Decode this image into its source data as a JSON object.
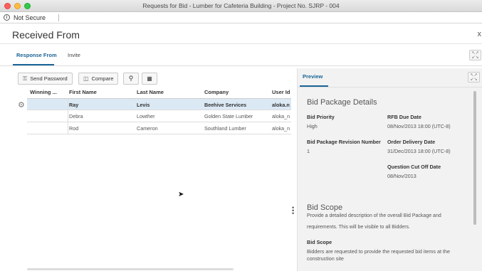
{
  "window": {
    "title": "Requests for Bid - Lumber for Cafeteria Building - Project No. SJRP - 004"
  },
  "urlbar": {
    "security_text": "Not Secure"
  },
  "page": {
    "title": "Received From",
    "close_glyph": "x"
  },
  "tabs": [
    {
      "label": "Response From"
    },
    {
      "label": "Invite"
    }
  ],
  "toolbar": {
    "send_password": "Send Password",
    "compare": "Compare"
  },
  "grid": {
    "headers": [
      "Winning ...",
      "First Name",
      "Last Name",
      "Company",
      "User Id"
    ],
    "rows": [
      {
        "first": "Ray",
        "last": "Levis",
        "company": "Beehive Services",
        "user": "aloka.n"
      },
      {
        "first": "Debra",
        "last": "Lowther",
        "company": "Golden State Lumber",
        "user": "aloka_n"
      },
      {
        "first": "Rod",
        "last": "Cameron",
        "company": "Southland Lumber",
        "user": "aloka_n"
      }
    ]
  },
  "preview": {
    "tab": "Preview",
    "details_title": "Bid Package Details",
    "bid_priority_label": "Bid Priority",
    "bid_priority_value": "High",
    "rfb_due_label": "RFB Due Date",
    "rfb_due_value": "08/Nov/2013 18:00 (UTC-8)",
    "revision_label": "Bid Package Revision Number",
    "revision_value": "1",
    "order_delivery_label": "Order Delivery Date",
    "order_delivery_value": "31/Dec/2013 18:00 (UTC-8)",
    "question_cutoff_label": "Question Cut Off Date",
    "question_cutoff_value": "08/Nov/2013",
    "scope_title": "Bid Scope",
    "scope_desc_1": "Provide a detailed description of the overall Bid Package and",
    "scope_desc_2": "requirements. This will be visible to all Bidders.",
    "scope_label": "Bid Scope",
    "scope_value_1": "Bidders are requested to provide the requested bid items at the",
    "scope_value_2": "construction site"
  },
  "colors": {
    "accent": "#1a6496",
    "selected_row": "#dbe9f5"
  }
}
